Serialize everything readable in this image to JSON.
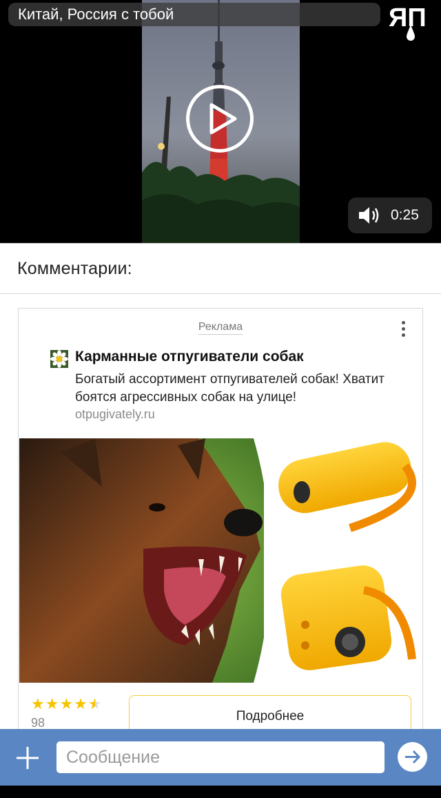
{
  "video": {
    "title": "Китай, Россия с тобой",
    "duration": "0:25",
    "logo_icon": "yap-logo",
    "play_icon": "play-icon",
    "volume_icon": "speaker-icon"
  },
  "comments": {
    "header": "Комментарии:"
  },
  "ad": {
    "label": "Реклама",
    "title": "Карманные отпугиватели собак",
    "text": "Богатый ассортимент отпугивателей собак! Хватит боятся агрессивных собак на улице!",
    "url": "otpugivately.ru",
    "rating_stars": 4.5,
    "rating_count": "98",
    "button_label": "Подробнее",
    "menu_icon": "more-vertical-icon",
    "brand_icon": "flower-icon"
  },
  "message_bar": {
    "placeholder": "Сообщение",
    "attach_icon": "plus-icon",
    "send_icon": "send-arrow-icon"
  },
  "colors": {
    "accent": "#5a87c3",
    "button_border": "#f3cf3b",
    "star": "#f5c400"
  }
}
